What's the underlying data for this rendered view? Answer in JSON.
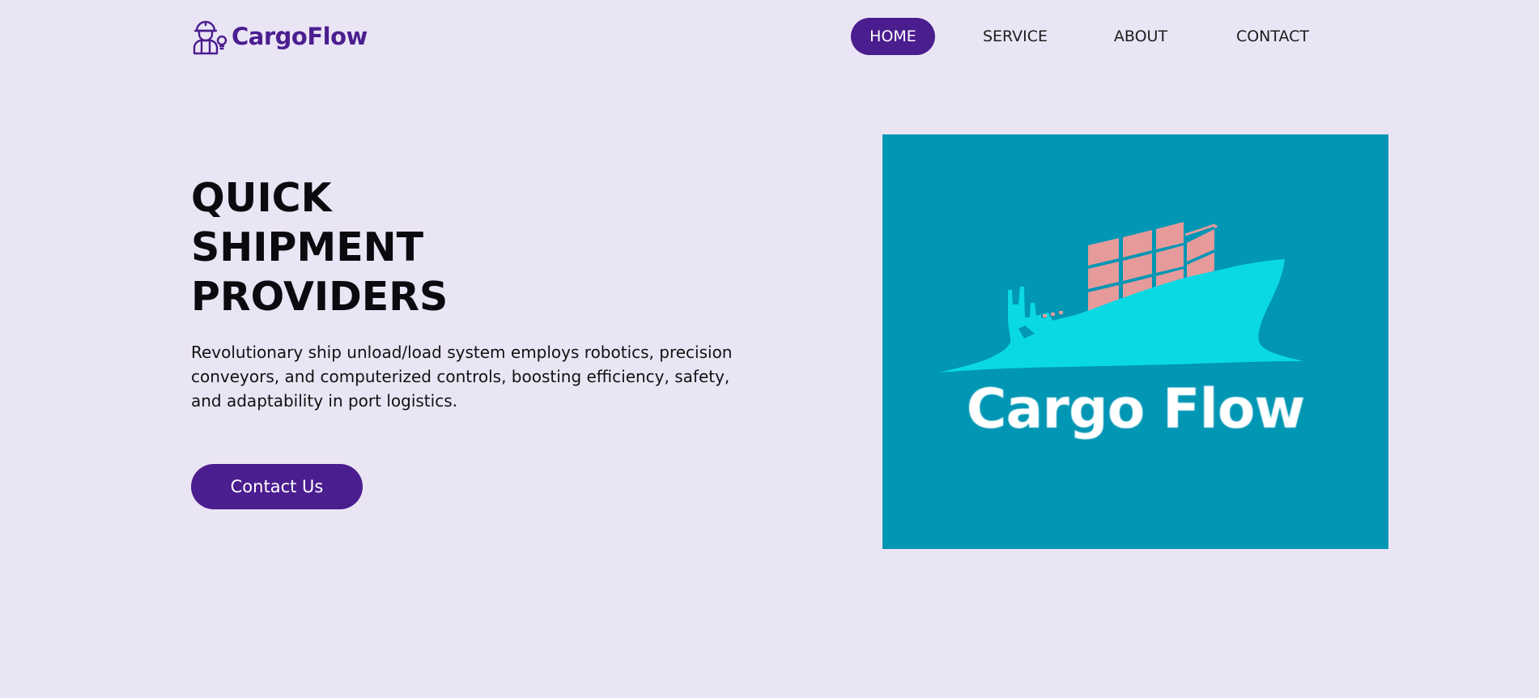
{
  "brand": {
    "name": "CargoFlow",
    "icon": "worker-lightbulb-icon",
    "color": "#4b1e8f"
  },
  "nav": {
    "items": [
      {
        "label": "HOME",
        "active": true
      },
      {
        "label": "SERVICE",
        "active": false
      },
      {
        "label": "ABOUT",
        "active": false
      },
      {
        "label": "CONTACT",
        "active": false
      }
    ]
  },
  "hero": {
    "title_lines": [
      "QUICK",
      "SHIPMENT",
      "PROVIDERS"
    ],
    "description": "Revolutionary ship unload/load system employs robotics, precision conveyors, and computerized controls, boosting efficiency, safety, and adaptability in port logistics.",
    "cta_label": "Contact Us"
  },
  "hero_image": {
    "brand_text": "Cargo Flow",
    "background_color": "#0096b4",
    "ship_color": "#0ad9e4",
    "container_color": "#e69a9a",
    "icon": "cargo-ship-icon"
  },
  "colors": {
    "page_background": "#eae5f5",
    "accent": "#4b1e8f"
  }
}
